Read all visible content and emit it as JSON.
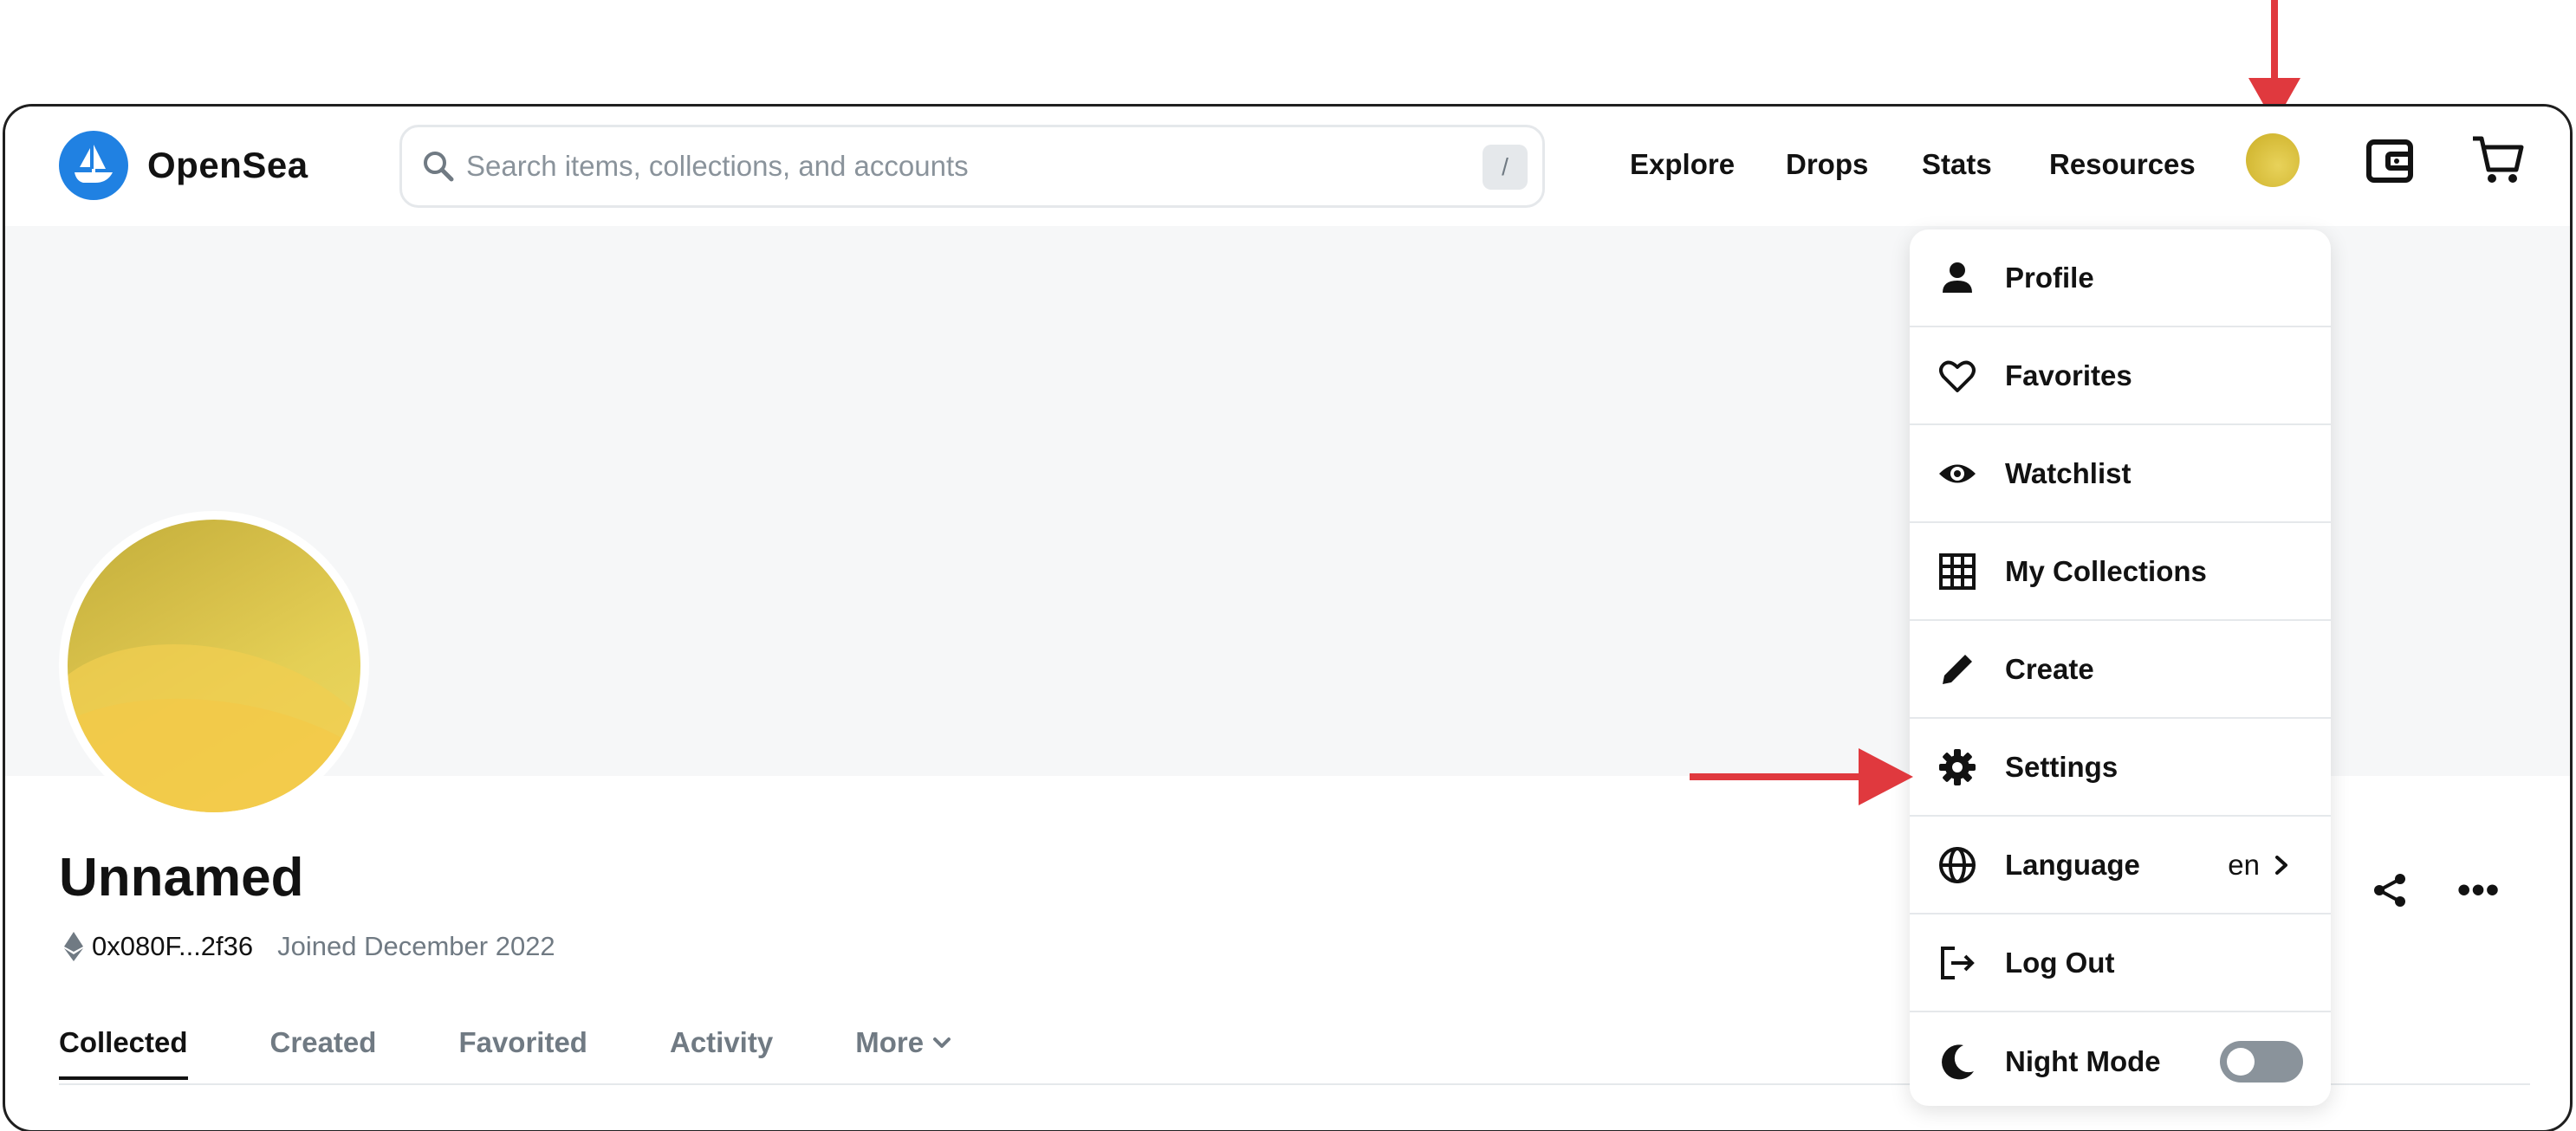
{
  "brand": {
    "name": "OpenSea"
  },
  "search": {
    "placeholder": "Search items, collections, and accounts",
    "shortcut": "/"
  },
  "nav": {
    "links": [
      {
        "label": "Explore"
      },
      {
        "label": "Drops"
      },
      {
        "label": "Stats"
      },
      {
        "label": "Resources"
      }
    ]
  },
  "profile": {
    "name": "Unnamed",
    "address": "0x080F...2f36",
    "joined": "Joined December 2022",
    "more_dots": "•••"
  },
  "tabs": [
    {
      "label": "Collected",
      "active": true
    },
    {
      "label": "Created"
    },
    {
      "label": "Favorited"
    },
    {
      "label": "Activity"
    },
    {
      "label": "More"
    }
  ],
  "menu": {
    "items": [
      {
        "label": "Profile",
        "icon": "person-icon"
      },
      {
        "label": "Favorites",
        "icon": "heart-icon"
      },
      {
        "label": "Watchlist",
        "icon": "eye-icon"
      },
      {
        "label": "My Collections",
        "icon": "grid-icon"
      },
      {
        "label": "Create",
        "icon": "pencil-icon"
      },
      {
        "label": "Settings",
        "icon": "gear-icon"
      },
      {
        "label": "Language",
        "icon": "globe-icon",
        "value": "en"
      },
      {
        "label": "Log Out",
        "icon": "logout-icon"
      },
      {
        "label": "Night Mode",
        "icon": "moon-icon",
        "toggle": false
      }
    ]
  },
  "colors": {
    "brand_blue": "#2081e2",
    "annotation_red": "#e0393e",
    "avatar_yellow": "#e4cf55"
  }
}
